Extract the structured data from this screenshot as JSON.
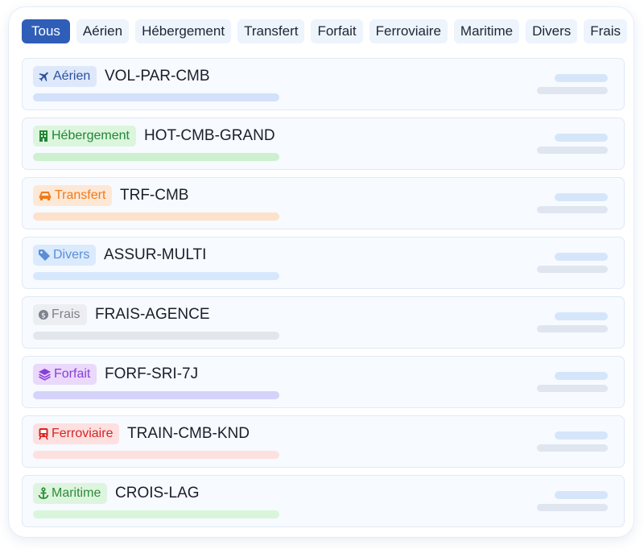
{
  "tabs": [
    "Tous",
    "Aérien",
    "Hébergement",
    "Transfert",
    "Forfait",
    "Ferroviaire",
    "Maritime",
    "Divers",
    "Frais"
  ],
  "rows": [
    {
      "category": "Aérien",
      "code": "VOL-PAR-CMB",
      "icon": "plane-icon",
      "badge_bg": "#dde8fb",
      "color": "#2c4f9e",
      "bar": "#d3e1fa"
    },
    {
      "category": "Hébergement",
      "code": "HOT-CMB-GRAND",
      "icon": "hotel-icon",
      "badge_bg": "#dcf5dd",
      "color": "#238636",
      "bar": "#cdf1cf"
    },
    {
      "category": "Transfert",
      "code": "TRF-CMB",
      "icon": "car-icon",
      "badge_bg": "#fde8d6",
      "color": "#f07b1a",
      "bar": "#fde2cb"
    },
    {
      "category": "Divers",
      "code": "ASSUR-MULTI",
      "icon": "tag-icon",
      "badge_bg": "#dbeafd",
      "color": "#5b8ed6",
      "bar": "#d7e8fc"
    },
    {
      "category": "Frais",
      "code": "FRAIS-AGENCE",
      "icon": "coin-icon",
      "badge_bg": "#eceef1",
      "color": "#7d828c",
      "bar": "#e3e6ea"
    },
    {
      "category": "Forfait",
      "code": "FORF-SRI-7J",
      "icon": "layers-icon",
      "badge_bg": "#ead9fb",
      "color": "#8a3ed8",
      "bar": "#d6d3fa"
    },
    {
      "category": "Ferroviaire",
      "code": "TRAIN-CMB-KND",
      "icon": "train-icon",
      "badge_bg": "#fde0e0",
      "color": "#d62424",
      "bar": "#fde1e1"
    },
    {
      "category": "Maritime",
      "code": "CROIS-LAG",
      "icon": "anchor-icon",
      "badge_bg": "#ddf5de",
      "color": "#2e8b3a",
      "bar": "#d9f6da"
    }
  ],
  "active_tab_color": "#2f5eb8"
}
